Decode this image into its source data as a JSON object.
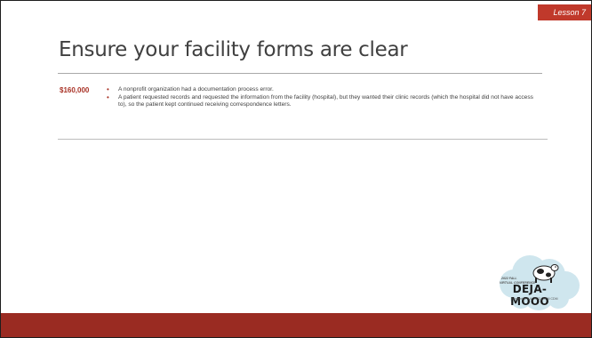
{
  "slide": {
    "lesson_tag": "Lesson 7",
    "title": "Ensure your facility forms are clear",
    "amount": "$160,000",
    "bullets": [
      "A nonprofit organization had a documentation process error.",
      "A patient requested records and requested the information from the facility (hospital), but they wanted their clinic records (which the hospital did not have access to), so the patient kept continued receiving correspondence letters."
    ]
  },
  "logo": {
    "brand": "DEJA-MOOO",
    "line1": "2022 FALL",
    "line2": "VIRTUAL CONFERENCE",
    "dates": "November 5-6, 2022 | HPM CDM"
  },
  "colors": {
    "accent": "#a93226",
    "footer": "#9a2b22",
    "lesson_tag": "#c0392b",
    "title": "#404040"
  }
}
